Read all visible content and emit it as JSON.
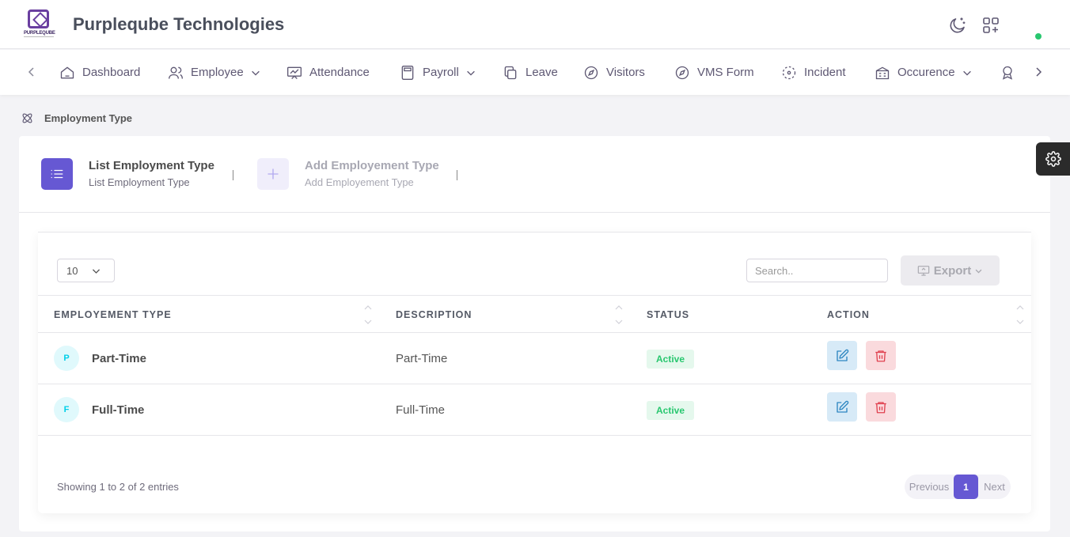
{
  "header": {
    "logo_text": "PURPLEQUBE",
    "brand": "Purpleqube Technologies"
  },
  "nav": {
    "items": [
      {
        "label": "Dashboard"
      },
      {
        "label": "Employee"
      },
      {
        "label": "Attendance"
      },
      {
        "label": "Payroll"
      },
      {
        "label": "Leave"
      },
      {
        "label": "Visitors"
      },
      {
        "label": "VMS Form"
      },
      {
        "label": "Incident"
      },
      {
        "label": "Occurence"
      }
    ]
  },
  "breadcrumb": {
    "label": "Employment Type"
  },
  "tabs": [
    {
      "title": "List Employment Type",
      "subtitle": "List Employment Type"
    },
    {
      "title": "Add Employement Type",
      "subtitle": "Add Employement Type"
    }
  ],
  "table": {
    "page_length": "10",
    "search_placeholder": "Search..",
    "export_label": "Export",
    "columns": [
      "EMPLOYEMENT TYPE",
      "DESCRIPTION",
      "STATUS",
      "ACTION"
    ],
    "rows": [
      {
        "initial": "P",
        "type": "Part-Time",
        "description": "Part-Time",
        "status": "Active"
      },
      {
        "initial": "F",
        "type": "Full-Time",
        "description": "Full-Time",
        "status": "Active"
      }
    ],
    "info": "Showing 1 to 2 of 2 entries",
    "pagination": {
      "previous": "Previous",
      "current": "1",
      "next": "Next"
    }
  },
  "colors": {
    "accent": "#6658d3",
    "success": "#28c76f",
    "info": "#00cfe8",
    "danger": "#ea5455",
    "brand": "#6a3fa0"
  }
}
